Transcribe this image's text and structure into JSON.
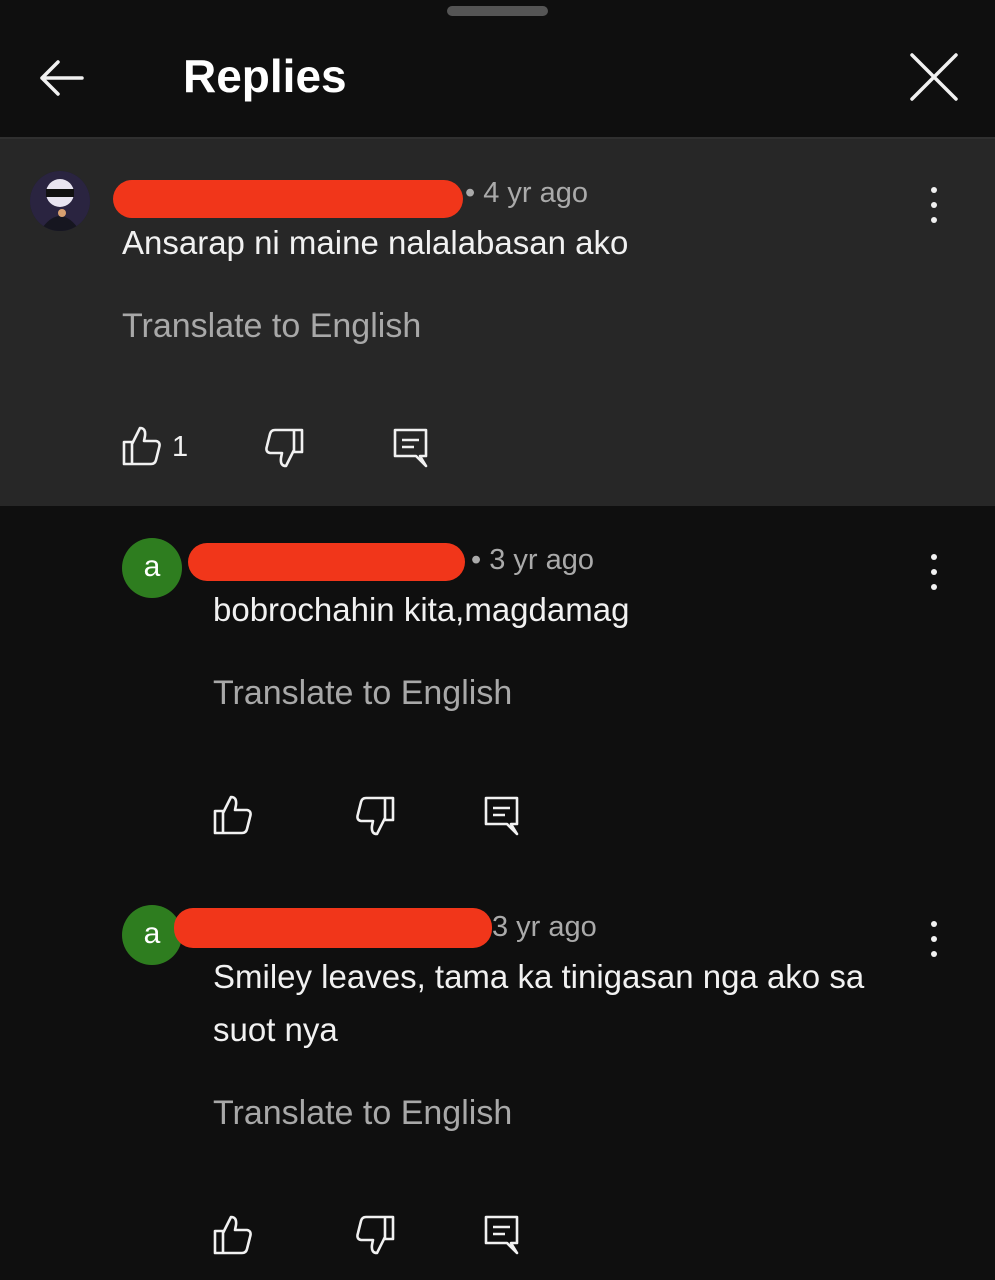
{
  "header": {
    "title": "Replies"
  },
  "comments": [
    {
      "avatar": "photo-avatar",
      "time": "4 yr ago",
      "text": "Ansarap ni maine nalalabasan ako",
      "translate": "Translate to English",
      "likes": "1",
      "highlighted": true
    },
    {
      "avatar_letter": "a",
      "time": "3 yr ago",
      "text": "bobrochahin kita,magdamag",
      "translate": "Translate to English",
      "likes": ""
    },
    {
      "avatar_letter": "a",
      "time": "3 yr ago",
      "text": "Smiley leaves, tama ka tinigasan nga ako sa suot nya",
      "translate": "Translate to English",
      "likes": ""
    }
  ],
  "colors": {
    "background": "#0f0f0f",
    "highlight": "#272727",
    "avatar_green": "#2e7d1f",
    "redaction": "#f1361a"
  },
  "icons": [
    "back-arrow-icon",
    "close-icon",
    "more-vert-icon",
    "thumb-up-icon",
    "thumb-down-icon",
    "reply-icon"
  ]
}
